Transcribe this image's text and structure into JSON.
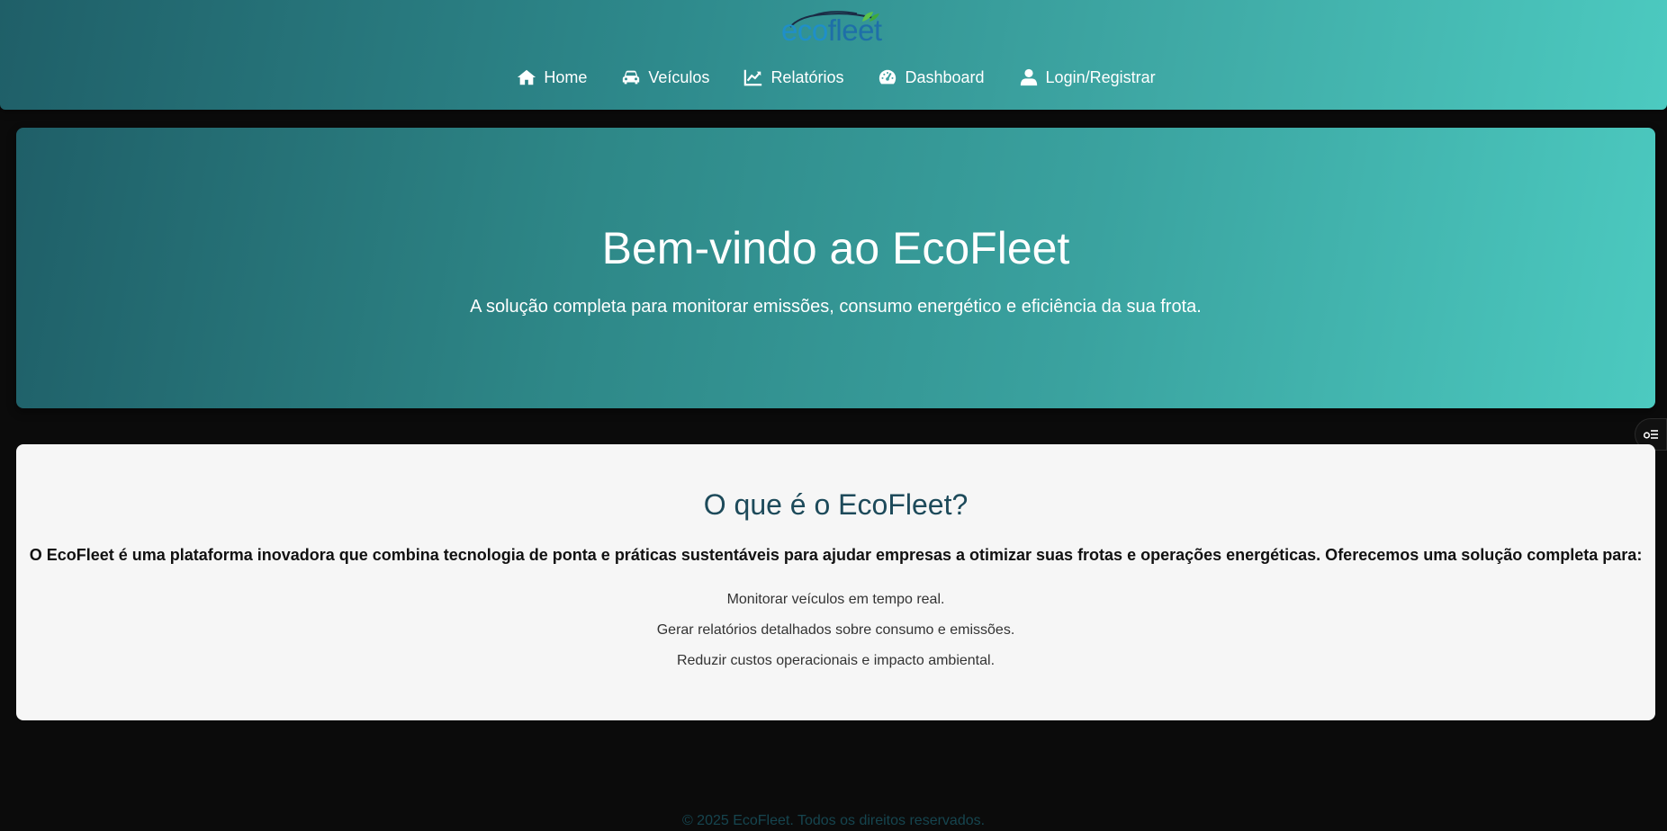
{
  "brand": {
    "logo_eco": "eco",
    "logo_fleet": "fleet",
    "colors": {
      "eco": "#1f8fc9",
      "fleet": "#1e6fa8",
      "leaf": "#5cc34a"
    }
  },
  "nav": {
    "items": [
      {
        "label": "Home",
        "icon": "home-icon"
      },
      {
        "label": "Veículos",
        "icon": "car-icon"
      },
      {
        "label": "Relatórios",
        "icon": "chart-line-icon"
      },
      {
        "label": "Dashboard",
        "icon": "gauge-icon"
      },
      {
        "label": "Login/Registrar",
        "icon": "user-icon"
      }
    ]
  },
  "hero": {
    "title": "Bem-vindo ao EcoFleet",
    "subtitle": "A solução completa para monitorar emissões, consumo energético e eficiência da sua frota."
  },
  "about": {
    "title": "O que é o EcoFleet?",
    "text": "O EcoFleet é uma plataforma inovadora que combina tecnologia de ponta e práticas sustentáveis para ajudar empresas a otimizar suas frotas e operações energéticas. Oferecemos uma solução completa para:",
    "items": [
      "Monitorar veículos em tempo real.",
      "Gerar relatórios detalhados sobre consumo e emissões.",
      "Reduzir custos operacionais e impacto ambiental."
    ]
  },
  "side_button": {
    "icon": "settings-toggle-icon"
  },
  "footer": {
    "text": "© 2025 EcoFleet. Todos os direitos reservados."
  },
  "theme": {
    "header_gradient_start": "#1f5f68",
    "header_gradient_end": "#4ccac0",
    "page_background": "#0b0b0b",
    "card_background": "#f6f6f6",
    "heading_color": "#1d4a5a"
  }
}
